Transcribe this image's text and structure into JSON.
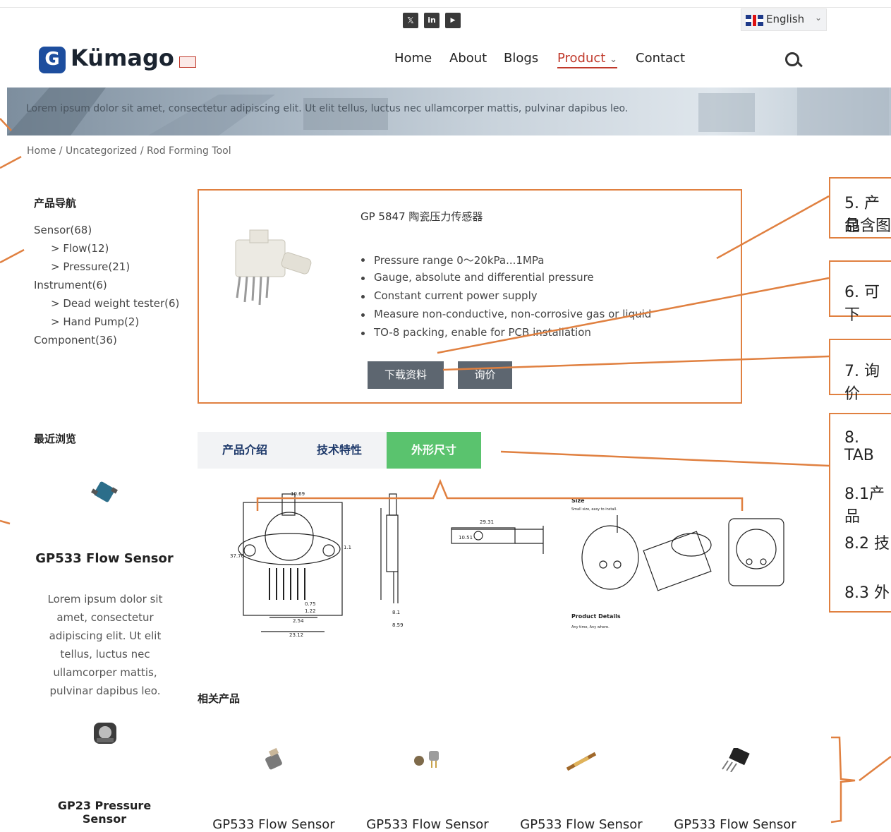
{
  "header": {
    "social": [
      {
        "icon": "x-icon",
        "glyph": "𝕏"
      },
      {
        "icon": "linkedin-icon",
        "glyph": "in"
      },
      {
        "icon": "youtube-icon",
        "glyph": "▶"
      }
    ],
    "language": {
      "label": "English",
      "chevron": "⌄"
    },
    "brand": "Kümago",
    "logo_glyph": "G",
    "nav": [
      "Home",
      "About",
      "Blogs",
      "Product",
      "Contact"
    ],
    "nav_product_chevron": "⌄"
  },
  "banner": {
    "text": "Lorem ipsum dolor sit amet, consectetur adipiscing elit. Ut elit tellus, luctus nec ullamcorper mattis, pulvinar dapibus leo."
  },
  "breadcrumb": "Home / Uncategorized / Rod Forming Tool",
  "sidebar": {
    "nav_title": "产品导航",
    "categories": [
      "Sensor(68)",
      "> Flow(12)",
      "> Pressure(21)",
      "Instrument(6)",
      "> Dead weight tester(6)",
      "> Hand Pump(2)",
      "Component(36)"
    ],
    "recent_title": "最近浏览",
    "recent": [
      {
        "name": "GP533 Flow Sensor",
        "desc": "Lorem ipsum dolor sit amet, consectetur adipiscing elit. Ut elit tellus, luctus nec ullamcorper mattis, pulvinar dapibus leo."
      },
      {
        "name": "GP23 Pressure Sensor"
      }
    ]
  },
  "product": {
    "title": "GP 5847 陶瓷压力传感器",
    "features": [
      "Pressure range 0〜20kPa...1MPa",
      "Gauge, absolute and differential pressure",
      "Constant current power supply",
      "Measure non-conductive, non-corrosive gas or liquid",
      "TO-8 packing, enable for PCB installation"
    ],
    "download_label": "下载资料",
    "inquiry_label": "询价"
  },
  "tabs": [
    "产品介绍",
    "技术特性",
    "外形尺寸"
  ],
  "drawing": {
    "dims": [
      "10.69",
      "37.76",
      "1.1",
      "8.1",
      "8.59",
      "29.31",
      "10.51",
      "2.54",
      "23.12",
      "0.75",
      "1.22"
    ],
    "size_title": "Size",
    "size_sub": "Small size, easy to install.",
    "details_title": "Product Details",
    "details_sub": "Any time, Any where."
  },
  "related": {
    "title": "相关产品",
    "items": [
      "GP533 Flow Sensor",
      "GP533 Flow Sensor",
      "GP533 Flow Sensor",
      "GP533 Flow Sensor"
    ]
  },
  "annotations": {
    "a5": "5. 产品",
    "a5b": "包含图",
    "a6": "6. 可下",
    "a7": "7. 询价",
    "a8": "8. TAB",
    "a81": "8.1产品",
    "a82": "8.2 技",
    "a83": "8.3 外"
  },
  "colors": {
    "accent": "#e08040",
    "active_tab": "#5ac36e",
    "nav_active": "#c0392b",
    "button": "#5d6670"
  }
}
